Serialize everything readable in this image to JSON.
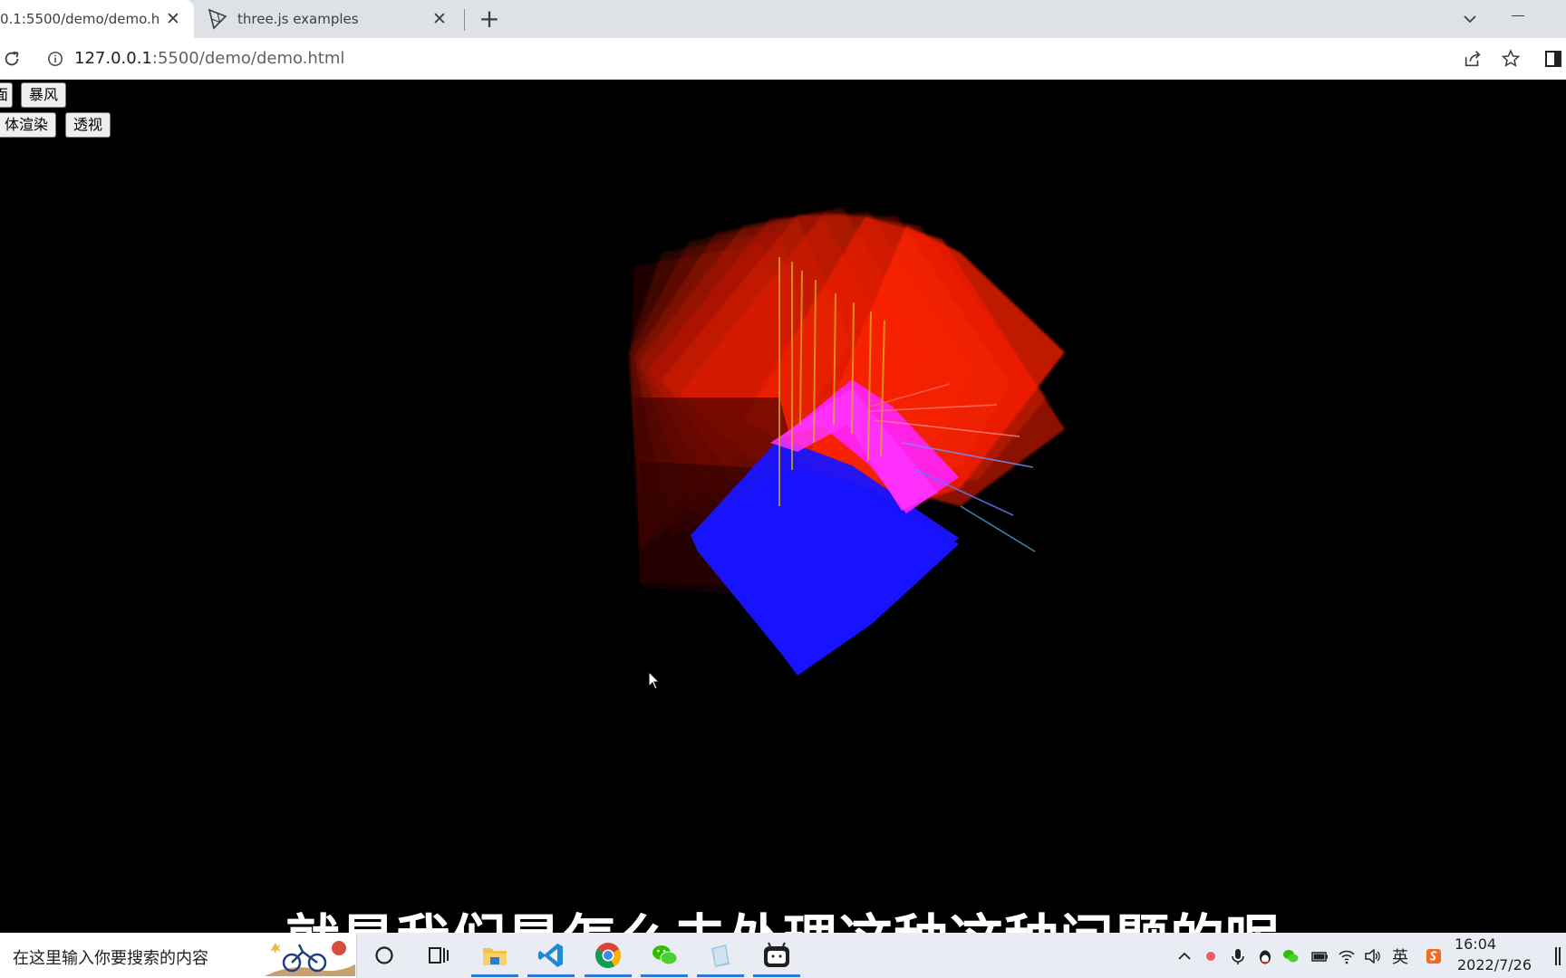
{
  "browser": {
    "active_tab": {
      "title": "0.1:5500/demo/demo.ht",
      "close": "✕"
    },
    "inactive_tab": {
      "title": "three.js examples",
      "close": "✕"
    },
    "new_tab": "+",
    "url_host": "127.0.0.1",
    "url_rest": ":5500/demo/demo.html"
  },
  "page": {
    "buttons": {
      "clipped_label": "面",
      "storm_label": "暴风",
      "volume_label": "体渲染",
      "perspective_label": "透视"
    },
    "subtitle": "就是我们是怎么去处理这种这种问题的呢"
  },
  "taskbar": {
    "search_placeholder": "在这里输入你要搜索的内容",
    "icons": [
      "cortana-circle-icon",
      "task-view-icon",
      "file-explorer-icon",
      "vscode-icon",
      "chrome-icon",
      "wechat-icon",
      "notepad-icon",
      "bilibili-icon"
    ],
    "tray": {
      "ime_label": "英"
    },
    "clock": {
      "time": "16:04",
      "date": "2022/7/26"
    }
  },
  "colors": {
    "scene_red": "#ff2200",
    "scene_blue": "#1a14ff",
    "scene_magenta": "#ff22ff",
    "page_background": "#000000",
    "taskbar_accent": "#2a7ad6"
  }
}
